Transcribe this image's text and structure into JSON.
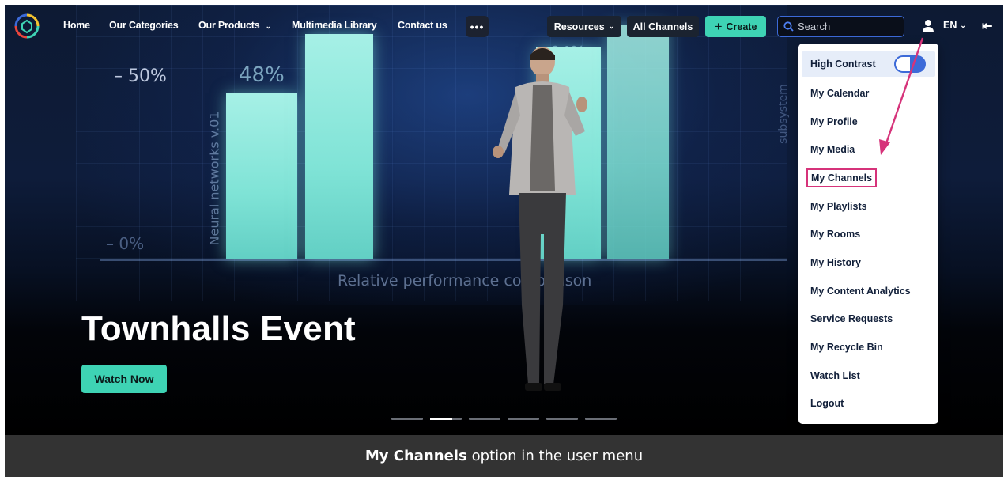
{
  "navbar": {
    "links": [
      "Home",
      "Our Categories",
      "Our Products",
      "Multimedia Library",
      "Contact us"
    ],
    "more_label": "•••",
    "resources_label": "Resources",
    "all_channels_label": "All Channels",
    "create_label": "Create",
    "search_placeholder": "Search",
    "language": "EN"
  },
  "hero": {
    "title": "Townhalls Event",
    "cta_label": "Watch Now",
    "screen_labels": {
      "tick_high": "– 50%",
      "tick_low": "– 0%",
      "bar_value": "48%",
      "bar_value_2": "94%",
      "vertical_label": "Neural networks v.01",
      "side_label": "subsystem",
      "footer_label": "Relative performance comparison"
    },
    "slides_count": 6,
    "active_slide": 2
  },
  "user_menu": {
    "high_contrast_label": "High Contrast",
    "items": [
      "My Calendar",
      "My Profile",
      "My Media",
      "My Channels",
      "My Playlists",
      "My Rooms",
      "My History",
      "My Content Analytics",
      "Service Requests",
      "My Recycle Bin",
      "Watch List",
      "Logout"
    ],
    "highlighted_item": "My Channels"
  },
  "caption": {
    "bold": "My Channels",
    "rest": "option in the user menu"
  },
  "colors": {
    "accent": "#3ed3b4",
    "highlight": "#d6337a",
    "toggle": "#3c6ad8"
  }
}
